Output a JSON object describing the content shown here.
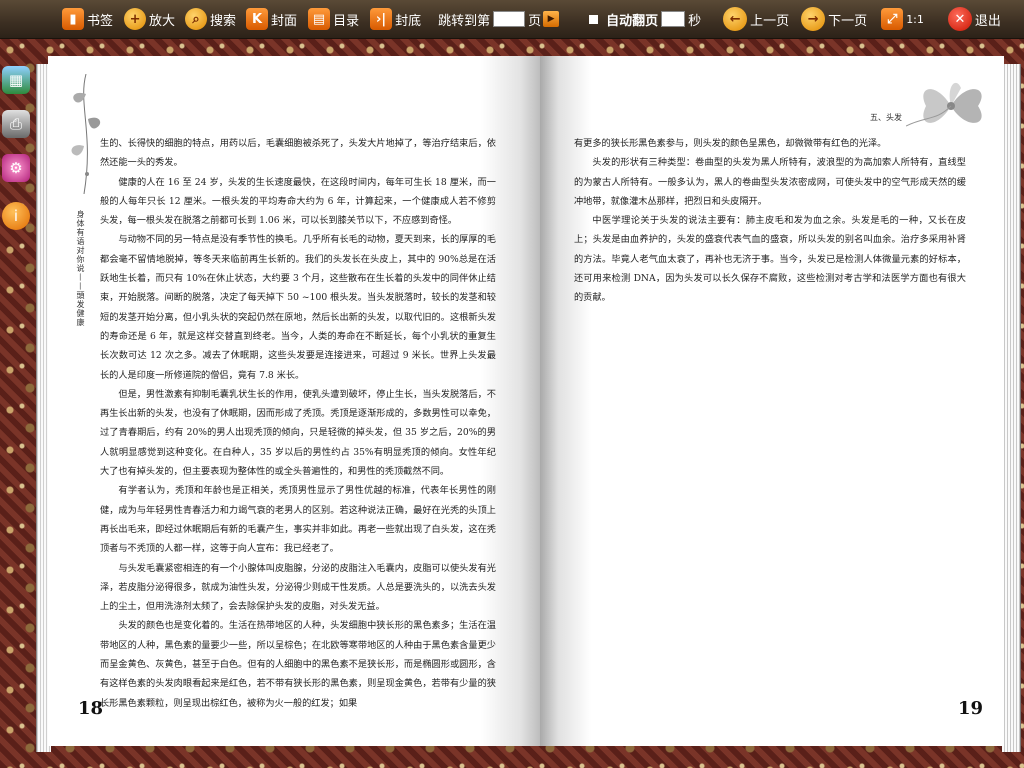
{
  "toolbar": {
    "bookmark": "书签",
    "zoom": "放大",
    "search": "搜索",
    "cover": "封面",
    "toc": "目录",
    "back_cover": "封底",
    "jump_to_label": "跳转到第",
    "page_unit": "页",
    "auto_flip": "自动翻页",
    "seconds_unit": "秒",
    "prev_page": "上一页",
    "next_page": "下一页",
    "ratio": "1:1",
    "exit": "退出"
  },
  "icons": {
    "bookmark": "bookmark-icon",
    "zoom": "zoom-in-icon",
    "search": "search-icon",
    "cover": "cover-icon",
    "toc": "book-icon",
    "back_cover": "back-cover-icon",
    "go": "play-icon",
    "prev": "arrow-left-icon",
    "next": "arrow-right-icon",
    "ratio": "fit-icon",
    "exit": "close-icon"
  },
  "left_page": {
    "number": "18",
    "running_head": "身体有语对你说——頭发健康",
    "paragraphs": [
      {
        "cont": true,
        "text": "生的、长得快的细胞的特点，用药以后，毛囊细胞被杀死了，头发大片地掉了，等治疗结束后，依然还能一头的秀发。"
      },
      {
        "cont": false,
        "text": "健康的人在 16 至 24 岁，头发的生长速度最快，在这段时间内，每年可生长 18 厘米，而一般的人每年只长 12 厘米。一根头发的平均寿命大约为 6 年，计算起来，一个健康成人若不修剪头发，每一根头发在脱落之前都可长到 1.06 米，可以长到膝关节以下，不应感到奇怪。"
      },
      {
        "cont": false,
        "text": "与动物不同的另一特点是没有季节性的换毛。几乎所有长毛的动物，夏天到来，长的厚厚的毛都会毫不留情地脱掉，等冬天来临前再生长新的。我们的头发长在头皮上，其中的 90%总是在活跃地生长着，而只有 10%在休止状态，大约要 3 个月，这些散布在生长着的头发中的同伴休止结束，开始脱落。间断的脱落，决定了每天掉下 50 ~100 根头发。当头发脱落时，较长的发茎和较短的发茎开始分离，但小乳头状的突起仍然在原地，然后长出新的头发，以取代旧的。这根新头发的寿命还是 6 年，就是这样交替直到终老。当今，人类的寿命在不断延长，每个小乳状的重复生长次数可达 12 次之多。减去了休眠期，这些头发要是连接进来，可超过 9 米长。世界上头发最长的人是印度一所修道院的僧侣，竟有 7.8 米长。"
      },
      {
        "cont": false,
        "text": "但是，男性激素有抑制毛囊乳状生长的作用，使乳头遭到破坏，停止生长，当头发脱落后，不再生长出新的头发，也没有了休眠期，因而形成了秃顶。秃顶是逐渐形成的，多数男性可以幸免，过了青春期后，约有 20%的男人出现秃顶的倾向，只是轻微的掉头发，但 35 岁之后，20%的男人就明显感觉到这种变化。在白种人，35 岁以后的男性约占 35%有明显秃顶的倾向。女性年纪大了也有掉头发的，但主要表现为整体性的或全头普遍性的，和男性的秃顶截然不同。"
      },
      {
        "cont": false,
        "text": "有学者认为，秃顶和年龄也是正相关，秃顶男性显示了男性优越的标准，代表年长男性的刚健，成为与年轻男性青春活力和力竭气衰的老男人的区别。若这种说法正确，最好在光秃的头顶上再长出毛来，即经过休眠期后有新的毛囊产生，事实并非如此。再老一些就出现了白头发，这在秃顶者与不秃顶的人都一样，这等于向人宣布：我已经老了。"
      },
      {
        "cont": false,
        "text": "与头发毛囊紧密相连的有一个小腺体叫皮脂腺，分泌的皮脂注入毛囊内，皮脂可以使头发有光泽，若皮脂分泌得很多，就成为油性头发，分泌得少则成干性发质。人总是要洗头的，以洗去头发上的尘土，但用洗涤剂太频了，会去除保护头发的皮脂，对头发无益。"
      },
      {
        "cont": false,
        "text": "头发的颜色也是变化着的。生活在热带地区的人种，头发细胞中狭长形的黑色素多；生活在温带地区的人种，黑色素的量要少一些，所以呈棕色；在北欧等寒带地区的人种由于黑色素含量更少而呈金黄色、灰黄色，甚至于白色。但有的人细胞中的黑色素不是狭长形，而是椭圆形或圆形，含有这样色素的头发肉眼看起来是红色，若不带有狭长形的黑色素，则呈现金黄色，若带有少量的狭长形黑色素颗粒，则呈现出棕红色，被称为火一般的红发；如果"
      }
    ]
  },
  "right_page": {
    "number": "19",
    "running_head": "五、头发",
    "paragraphs": [
      {
        "cont": true,
        "text": "有更多的狭长形黑色素参与，则头发的颜色呈黑色，却微微带有红色的光泽。"
      },
      {
        "cont": false,
        "text": "头发的形状有三种类型：卷曲型的头发为黑人所特有，波浪型的为高加索人所特有，直线型的为蒙古人所特有。一般多认为，黑人的卷曲型头发浓密成网，可使头发中的空气形成天然的缓冲地带，就像灌木丛那样，把烈日和头皮隔开。"
      },
      {
        "cont": false,
        "text": "中医学理论关于头发的说法主要有：肺主皮毛和发为血之余。头发是毛的一种，又长在皮上；头发是由血养护的，头发的盛衰代表气血的盛衰，所以头发的别名叫血余。治疗多采用补肾的方法。毕竟人老气血太衰了，再补也无济于事。当今，头发已是检测人体微量元素的好标本，还可用来检测 DNA，因为头发可以长久保存不腐败，这些检测对考古学和法医学方面也有很大的贡献。"
      }
    ]
  }
}
